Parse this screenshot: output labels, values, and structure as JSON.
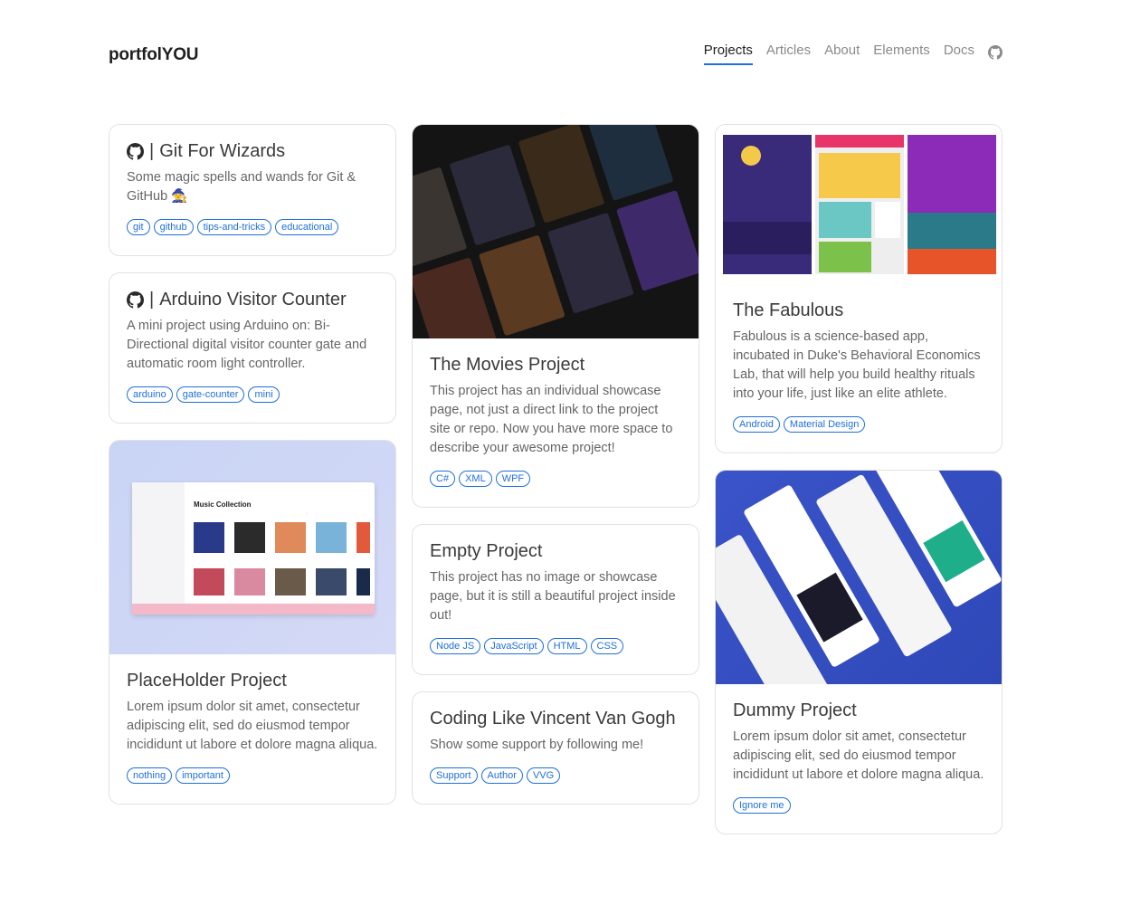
{
  "brand": "portfolYOU",
  "nav": {
    "items": [
      "Projects",
      "Articles",
      "About",
      "Elements",
      "Docs"
    ],
    "active": "Projects",
    "github_icon": "github-icon"
  },
  "cards": {
    "git_wizards": {
      "separator": "|",
      "title": "Git For Wizards",
      "desc": "Some magic spells and wands for Git & GitHub 🧙",
      "tags": [
        "git",
        "github",
        "tips-and-tricks",
        "educational"
      ]
    },
    "arduino": {
      "separator": "|",
      "title": "Arduino Visitor Counter",
      "desc": "A mini project using Arduino on: Bi-Directional digital visitor counter gate and automatic room light controller.",
      "tags": [
        "arduino",
        "gate-counter",
        "mini"
      ]
    },
    "placeholder": {
      "title": "PlaceHolder Project",
      "desc": "Lorem ipsum dolor sit amet, consectetur adipiscing elit, sed do eiusmod tempor incididunt ut labore et dolore magna aliqua.",
      "tags": [
        "nothing",
        "important"
      ],
      "image": {
        "app_title": "Music Collection"
      }
    },
    "movies": {
      "title": "The Movies Project",
      "desc": "This project has an individual showcase page, not just a direct link to the project site or repo. Now you have more space to describe your awesome project!",
      "tags": [
        "C#",
        "XML",
        "WPF"
      ]
    },
    "empty": {
      "title": "Empty Project",
      "desc": "This project has no image or showcase page, but it is still a beautiful project inside out!",
      "tags": [
        "Node JS",
        "JavaScript",
        "HTML",
        "CSS"
      ]
    },
    "vangogh": {
      "title": "Coding Like Vincent Van Gogh",
      "desc": "Show some support by following me!",
      "tags": [
        "Support",
        "Author",
        "VVG"
      ]
    },
    "fabulous": {
      "title": "The Fabulous",
      "desc": "Fabulous is a science-based app, incubated in Duke's Behavioral Economics Lab, that will help you build healthy rituals into your life, just like an elite athlete.",
      "tags": [
        "Android",
        "Material Design"
      ]
    },
    "dummy": {
      "title": "Dummy Project",
      "desc": "Lorem ipsum dolor sit amet, consectetur adipiscing elit, sed do eiusmod tempor incididunt ut labore et dolore magna aliqua.",
      "tags": [
        "Ignore me"
      ]
    }
  },
  "colors": {
    "accent": "#1f6fdc",
    "text": "#3a3a3a",
    "border": "#e2e2e2"
  }
}
